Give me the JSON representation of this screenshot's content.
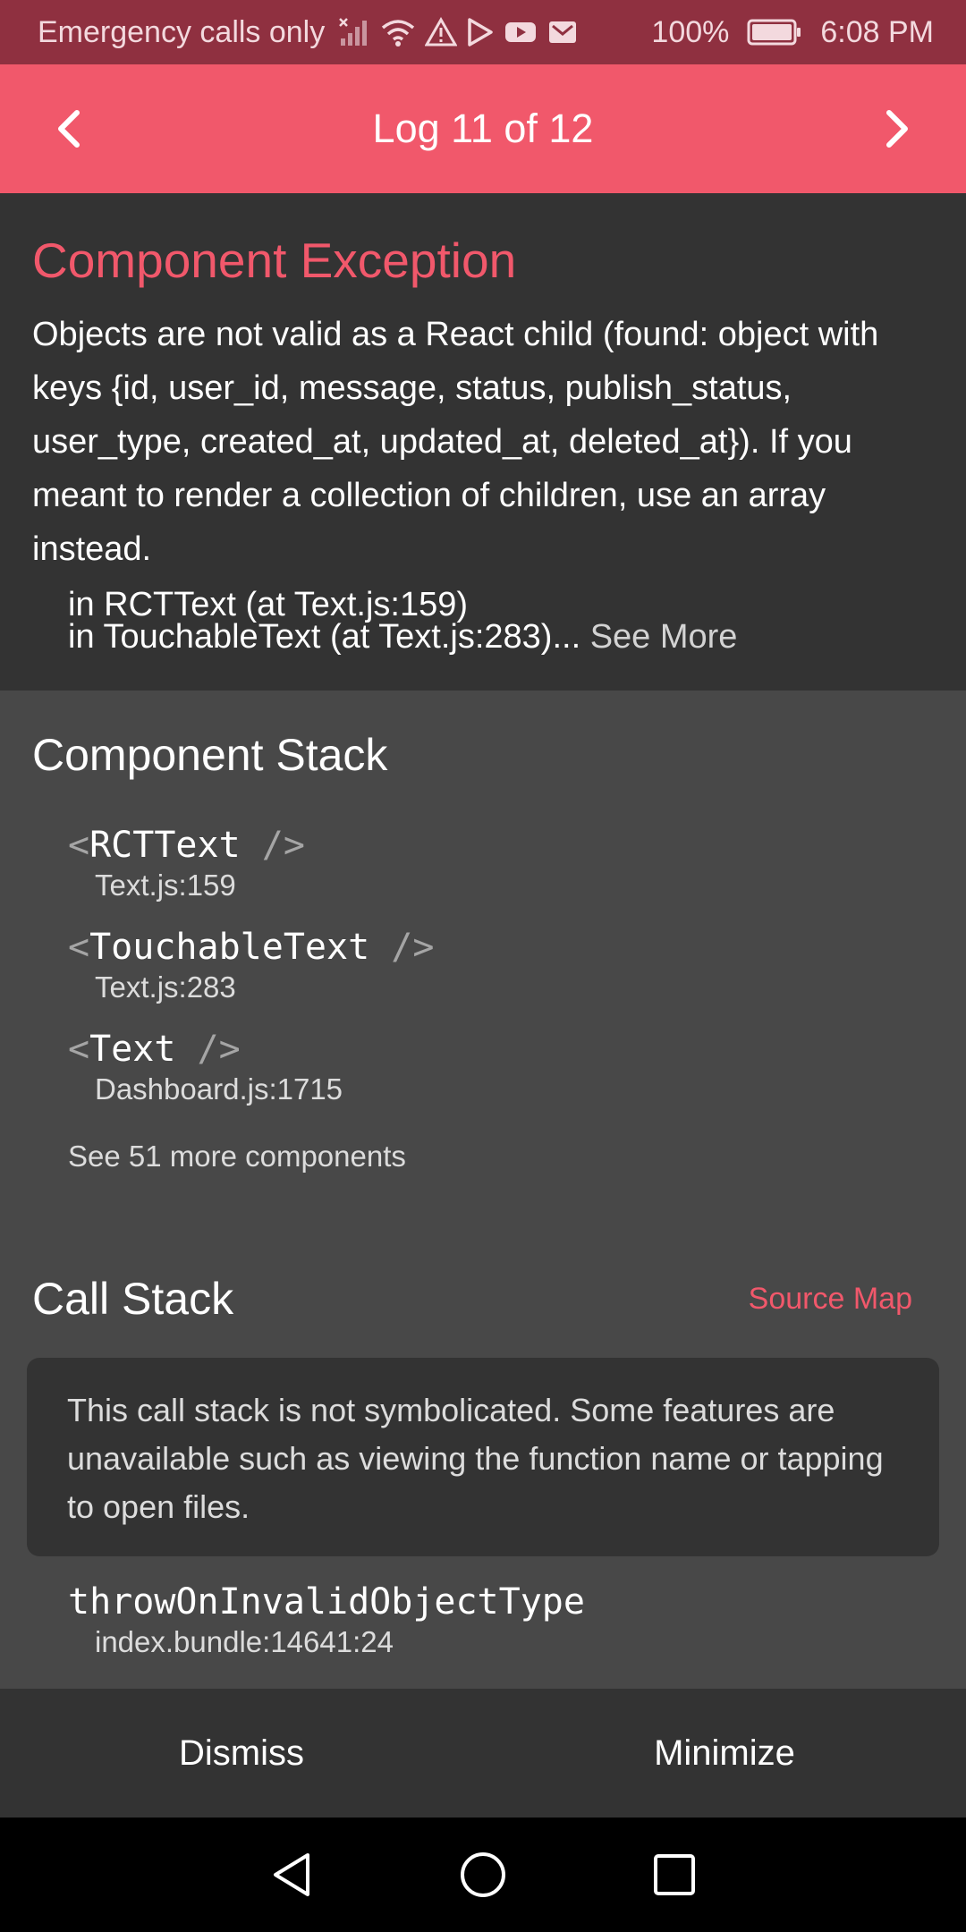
{
  "status_bar": {
    "carrier_text": "Emergency calls only",
    "battery": "100%",
    "time": "6:08 PM"
  },
  "header": {
    "title": "Log 11 of 12"
  },
  "exception": {
    "title": "Component Exception",
    "message": "Objects are not valid as a React child (found: object with keys {id, user_id, message, status, publish_status, user_type, created_at, updated_at, deleted_at}). If you meant to render a collection of children, use an array instead.",
    "stack_line_1": "in RCTText (at Text.js:159)",
    "stack_line_2": "in TouchableText (at Text.js:283)...",
    "see_more": " See More"
  },
  "component_stack": {
    "title": "Component Stack",
    "frames": [
      {
        "name": "RCTText",
        "location": "Text.js:159"
      },
      {
        "name": "TouchableText",
        "location": "Text.js:283"
      },
      {
        "name": "Text",
        "location": "Dashboard.js:1715"
      }
    ],
    "see_more": "See 51 more components"
  },
  "call_stack": {
    "title": "Call Stack",
    "source_map": "Source Map",
    "notice": "This call stack is not symbolicated. Some features are unavailable such as viewing the function name or tapping to open files.",
    "frames": [
      {
        "name": "throwOnInvalidObjectType",
        "location": "index.bundle:14641:24"
      }
    ]
  },
  "bottom_bar": {
    "dismiss": "Dismiss",
    "minimize": "Minimize"
  },
  "icons": {
    "prev": "chevron-left-icon",
    "next": "chevron-right-icon",
    "back": "back-triangle-icon",
    "home": "home-circle-icon",
    "recents": "recents-square-icon"
  },
  "colors": {
    "accent": "#f1586b",
    "status_bar": "#8f3040",
    "panel_dark": "#333333",
    "panel": "#484848"
  }
}
